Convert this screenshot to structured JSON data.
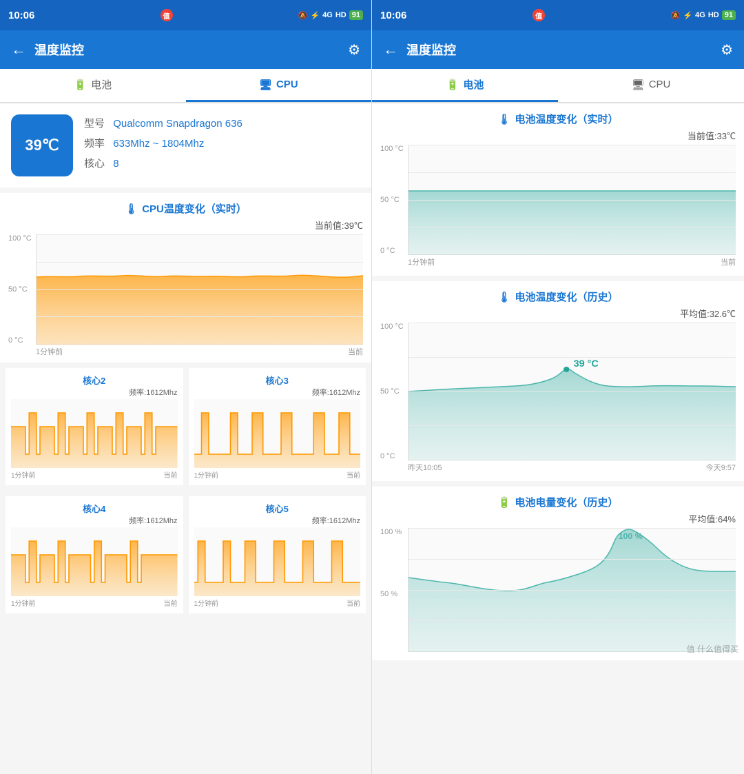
{
  "left_panel": {
    "status_bar": {
      "time": "10:06",
      "battery_number": "91"
    },
    "top_bar": {
      "back_label": "←",
      "title": "温度监控",
      "settings_icon": "⚙"
    },
    "tabs": [
      {
        "label": "电池",
        "icon": "🔋",
        "active": false
      },
      {
        "label": "CPU",
        "icon": "🖥",
        "active": true
      }
    ],
    "cpu_info": {
      "temperature": "39℃",
      "model_label": "型号",
      "model_value": "Qualcomm Snapdragon 636",
      "freq_label": "频率",
      "freq_value": "633Mhz ~ 1804Mhz",
      "core_label": "核心",
      "core_value": "8"
    },
    "cpu_realtime_chart": {
      "title": "CPU温度变化（实时）",
      "current_label": "当前值:39℃",
      "y_max": "100 °C",
      "y_mid": "50 °C",
      "y_min": "0 °C",
      "x_start": "1分钟前",
      "x_end": "当前"
    },
    "core_charts": [
      {
        "title": "核心2",
        "freq": "频率:1612Mhz",
        "x_start": "1分钟前",
        "x_end": "当前"
      },
      {
        "title": "核心3",
        "freq": "频率:1612Mhz",
        "x_start": "1分钟前",
        "x_end": "当前"
      },
      {
        "title": "核心4",
        "freq": "频率:1612Mhz",
        "x_start": "1分钟前",
        "x_end": "当前"
      },
      {
        "title": "核心5",
        "freq": "频率:1612Mhz",
        "x_start": "1分钟前",
        "x_end": "当前"
      }
    ]
  },
  "right_panel": {
    "status_bar": {
      "time": "10:06",
      "battery_number": "91"
    },
    "top_bar": {
      "back_label": "←",
      "title": "温度监控",
      "settings_icon": "⚙"
    },
    "tabs": [
      {
        "label": "电池",
        "icon": "🔋",
        "active": true
      },
      {
        "label": "CPU",
        "icon": "🖥",
        "active": false
      }
    ],
    "battery_realtime": {
      "title": "电池温度变化（实时）",
      "current_label": "当前值:33℃",
      "y_max": "100 °C",
      "y_mid": "50 °C",
      "y_min": "0 °C",
      "x_start": "1分钟前",
      "x_end": "当前"
    },
    "battery_history": {
      "title": "电池温度变化（历史）",
      "avg_label": "平均值:32.6℃",
      "peak_label": "39 °C",
      "y_max": "100 °C",
      "y_mid": "50 °C",
      "y_min": "0 °C",
      "x_start": "昨天10:05",
      "x_end": "今天9:57"
    },
    "battery_charge": {
      "title": "电池电量变化（历史）",
      "avg_label": "平均值:64%",
      "peak_label": "100 %",
      "y_max": "100 %",
      "y_mid": "50 %",
      "x_start": "",
      "x_end": ""
    },
    "watermark": "值 什么值得买"
  }
}
